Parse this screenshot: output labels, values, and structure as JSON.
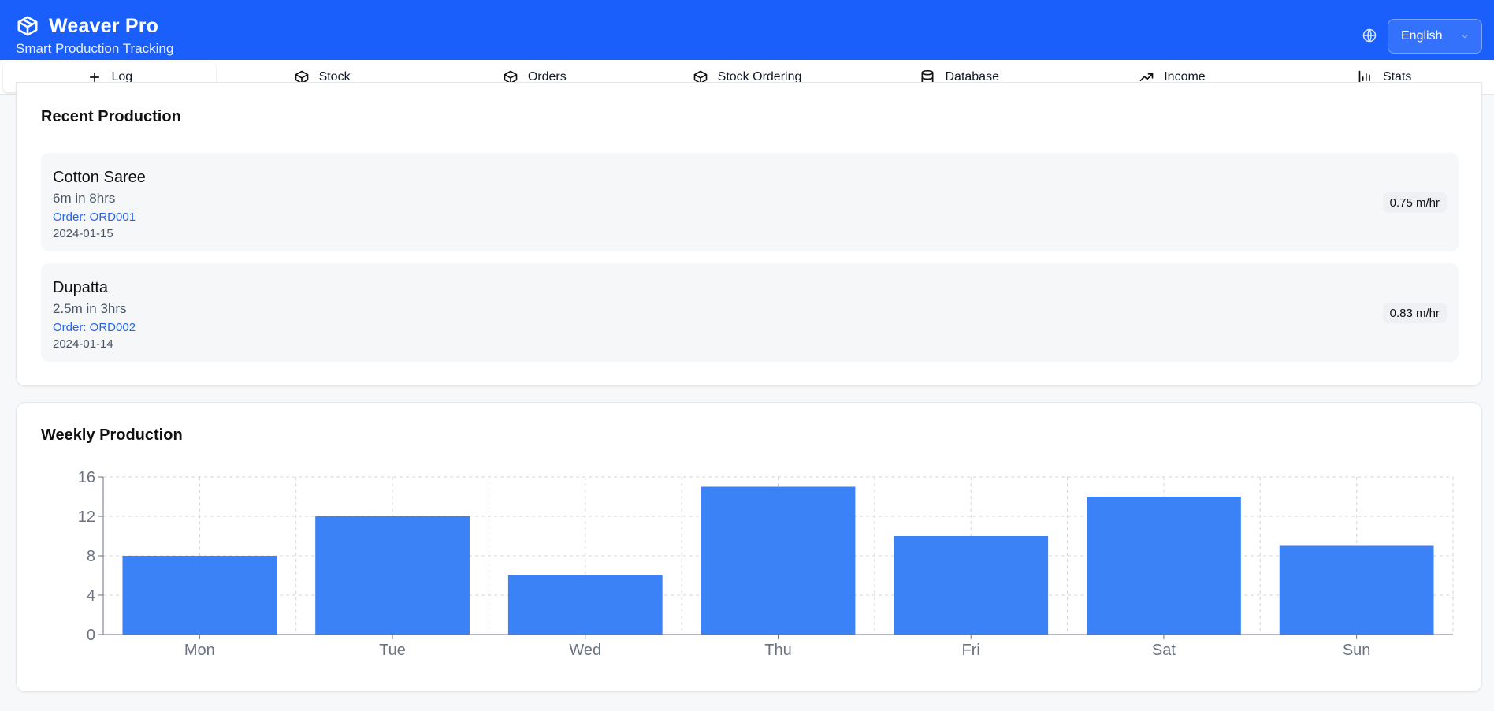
{
  "app": {
    "title": "Weaver Pro",
    "subtitle": "Smart Production Tracking",
    "language": "English",
    "logo_icon": "box-icon",
    "accent_color": "#1a5ffb"
  },
  "tabs": [
    {
      "label": "Log",
      "icon": "plus-icon",
      "active": true
    },
    {
      "label": "Stock",
      "icon": "box-icon"
    },
    {
      "label": "Orders",
      "icon": "box-icon"
    },
    {
      "label": "Stock Ordering",
      "icon": "box-icon"
    },
    {
      "label": "Database",
      "icon": "database-icon"
    },
    {
      "label": "Income",
      "icon": "trending-up-icon"
    },
    {
      "label": "Stats",
      "icon": "bar-chart-icon"
    }
  ],
  "recent": {
    "title": "Recent Production",
    "items": [
      {
        "name": "Cotton Saree",
        "qty": "6m in 8hrs",
        "order": "Order: ORD001",
        "date": "2024-01-15",
        "rate": "0.75 m/hr"
      },
      {
        "name": "Dupatta",
        "qty": "2.5m in 3hrs",
        "order": "Order: ORD002",
        "date": "2024-01-14",
        "rate": "0.83 m/hr"
      }
    ]
  },
  "weekly": {
    "title": "Weekly Production"
  },
  "chart_data": {
    "type": "bar",
    "categories": [
      "Mon",
      "Tue",
      "Wed",
      "Thu",
      "Fri",
      "Sat",
      "Sun"
    ],
    "values": [
      8,
      12,
      6,
      15,
      10,
      14,
      9
    ],
    "ylim": [
      0,
      16
    ],
    "yticks": [
      0,
      4,
      8,
      12,
      16
    ],
    "grid": true,
    "bar_color": "#3b82f6",
    "xlabel": "",
    "ylabel": ""
  }
}
